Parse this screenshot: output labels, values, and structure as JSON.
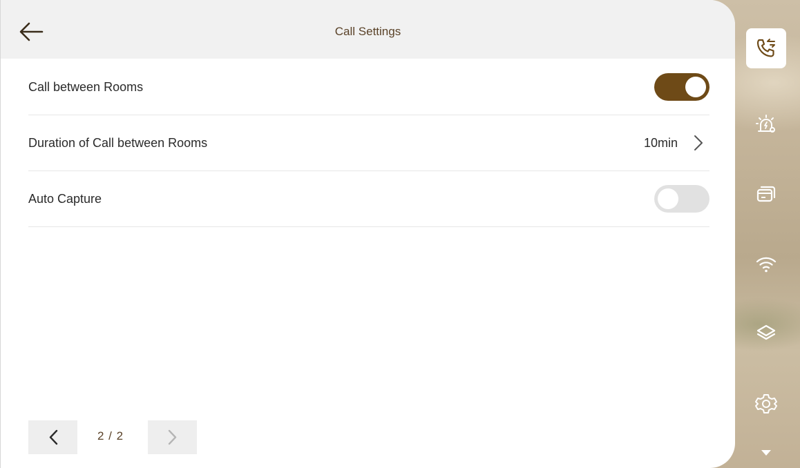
{
  "header": {
    "title": "Call Settings"
  },
  "settings": {
    "call_between_rooms": {
      "label": "Call between Rooms",
      "enabled": true
    },
    "duration": {
      "label": "Duration of Call between Rooms",
      "value": "10min"
    },
    "auto_capture": {
      "label": "Auto Capture",
      "enabled": false
    }
  },
  "pagination": {
    "indicator": "2 / 2",
    "current": 2,
    "total": 2
  },
  "sidebar": {
    "items": [
      "call-settings-icon",
      "alarm-icon",
      "card-icon",
      "wifi-icon",
      "layers-icon",
      "settings-gear-icon",
      "dropdown-arrow-icon"
    ],
    "active": "call-settings-icon"
  },
  "colors": {
    "accent": "#6e4a17",
    "title": "#5a4228",
    "header_bg": "#f1f1f1"
  }
}
